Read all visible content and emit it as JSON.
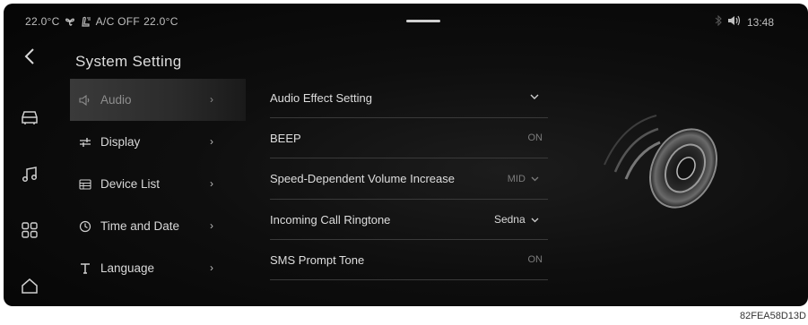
{
  "status": {
    "left_temp": "22.0°C",
    "ac_text": "A/C OFF",
    "right_temp": "22.0°C",
    "time": "13:48"
  },
  "title": "System Setting",
  "menu": [
    {
      "label": "Audio",
      "icon": "speaker-icon",
      "active": true
    },
    {
      "label": "Display",
      "icon": "sliders-icon",
      "active": false
    },
    {
      "label": "Device List",
      "icon": "device-list-icon",
      "active": false
    },
    {
      "label": "Time and Date",
      "icon": "clock-icon",
      "active": false
    },
    {
      "label": "Language",
      "icon": "text-t-icon",
      "active": false
    }
  ],
  "settings": [
    {
      "label": "Audio Effect Setting",
      "value": "",
      "control": "chevron-down"
    },
    {
      "label": "BEEP",
      "value": "ON",
      "control": "toggle-text"
    },
    {
      "label": "Speed-Dependent Volume Increase",
      "value": "MID",
      "control": "dropdown"
    },
    {
      "label": "Incoming Call Ringtone",
      "value": "Sedna",
      "control": "dropdown"
    },
    {
      "label": "SMS Prompt Tone",
      "value": "ON",
      "control": "toggle-text"
    }
  ],
  "footer_code": "82FEA58D13D",
  "colors": {
    "background": "#0e0e0e",
    "text": "#d8d8d8",
    "muted": "#7c7c7c",
    "divider": "#3a3a3a"
  }
}
